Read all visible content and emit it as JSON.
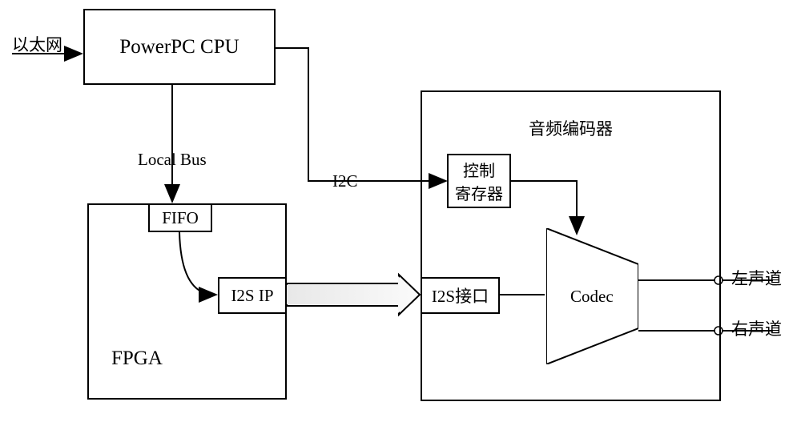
{
  "labels": {
    "ethernet": "以太网",
    "cpu": "PowerPC CPU",
    "local_bus": "Local Bus",
    "i2c": "I2C",
    "fpga": "FPGA",
    "fifo": "FIFO",
    "i2s_ip": "I2S IP",
    "audio_encoder": "音频编码器",
    "control_register_line1": "控制",
    "control_register_line2": "寄存器",
    "i2s_interface": "I2S接口",
    "codec": "Codec",
    "left_channel": "左声道",
    "right_channel": "右声道"
  }
}
